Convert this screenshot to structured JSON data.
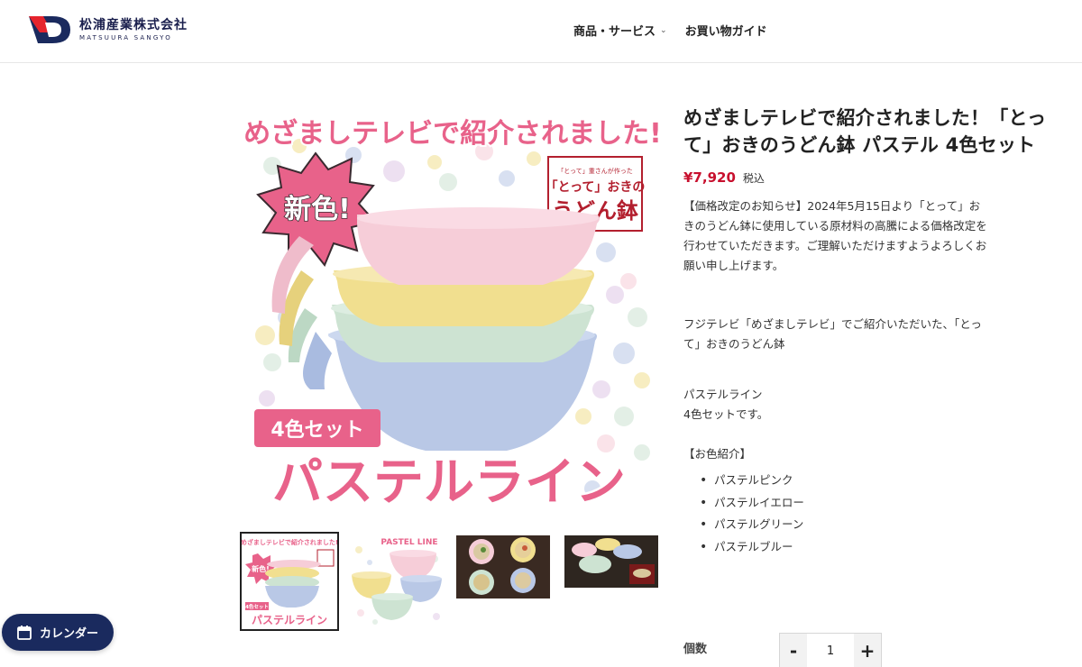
{
  "header": {
    "logo_jp": "松浦産業株式会社",
    "logo_en": "MATSUURA SANGYO",
    "nav": [
      {
        "label": "商品・サービス",
        "has_dropdown": true
      },
      {
        "label": "お買い物ガイド",
        "has_dropdown": false
      }
    ]
  },
  "gallery": {
    "main_image": {
      "banner": "めざましテレビで紹介されました!",
      "badge": "新色!",
      "logo_small": "「とって」重さんが作った",
      "logo_line1": "「とって」おきの",
      "logo_line2": "うどん鉢",
      "set_label": "4色セット",
      "line_name": "パステルライン"
    },
    "thumbs": [
      {
        "name": "thumb-main",
        "selected": true,
        "line1": "めざましテレビで紹介されました!",
        "badge": "新色!",
        "set": "4色セット",
        "line": "パステルライン"
      },
      {
        "name": "thumb-pastel-line",
        "selected": false,
        "caption": "PASTEL LINE"
      },
      {
        "name": "thumb-udon-bowls",
        "selected": false
      },
      {
        "name": "thumb-table-setting",
        "selected": false
      }
    ]
  },
  "product": {
    "title": "めざましテレビで紹介されました！「とって」おきのうどん鉢 パステル 4色セット",
    "price": "¥7,920",
    "tax_label": "税込",
    "notice": "【価格改定のお知らせ】2024年5月15日より「とって」おきのうどん鉢に使用している原材料の高騰による価格改定を行わせていただきます。ご理解いただけますようよろしくお願い申し上げます。",
    "tv_text": "フジテレビ「めざましテレビ」でご紹介いただいた、「とって」おきのうどん鉢",
    "line_name": "パステルライン",
    "set_text": "4色セットです。",
    "colors_heading": "【お色紹介】",
    "colors": [
      "パステルピンク",
      "パステルイエロー",
      "パステルグリーン",
      "パステルブルー"
    ]
  },
  "quantity": {
    "label": "個数",
    "minus": "-",
    "plus": "+",
    "value": "1"
  },
  "calendar_button": {
    "label": "カレンダー"
  },
  "colors_theme": {
    "brand_navy": "#1a2a5e",
    "price_red": "#c8102e",
    "pink": "#e8628a",
    "bowl_pink": "#f6cdd8",
    "bowl_yellow": "#f1df8f",
    "bowl_green": "#cde3d2",
    "bowl_blue": "#b9c8e6"
  }
}
